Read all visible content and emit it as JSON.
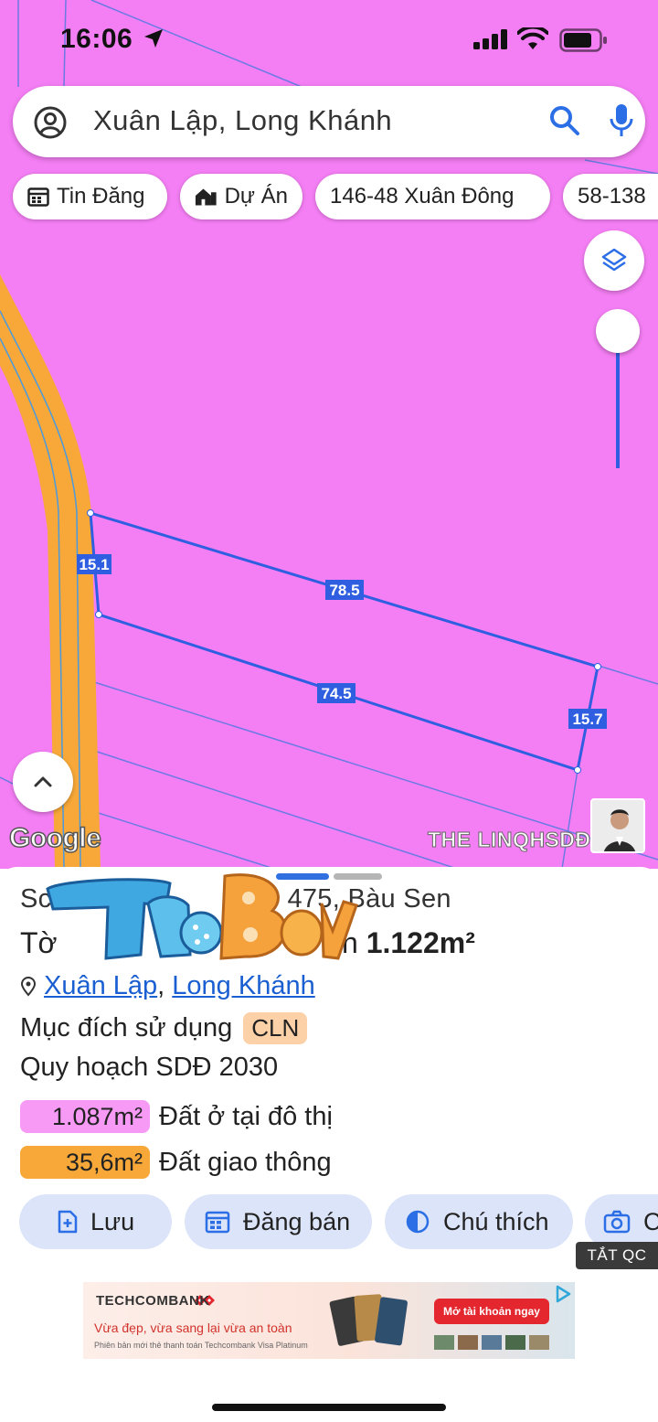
{
  "status_bar": {
    "time": "16:06"
  },
  "search": {
    "query": "Xuân Lập, Long Khánh"
  },
  "chips": [
    {
      "label": "Tin Đăng",
      "icon": "calendar-icon"
    },
    {
      "label": "Dự Án",
      "icon": "building-icon"
    },
    {
      "label": "146-48 Xuân Đông"
    },
    {
      "label": "58-138"
    }
  ],
  "map": {
    "background_color": "#f47ef4",
    "road_color": "#f7a838",
    "parcel_edge_color": "#2f5fe0",
    "edge_labels": [
      "15.1",
      "78.5",
      "74.5",
      "15.7"
    ],
    "attribution": "Google",
    "watermark": "THE LINQHSDĐ 2030"
  },
  "panel": {
    "title_visible": "Sc",
    "title_tail": "475, Bàu Sen",
    "sheet_prefix": "Tờ",
    "area_text": "ch ",
    "area_value": "1.122m²",
    "location": {
      "ward": "Xuân Lập",
      "separator": ",",
      "city": "Long Khánh"
    },
    "purpose_label": "Mục đích sử dụng",
    "purpose_code": "CLN",
    "plan_label": "Quy hoạch SDĐ 2030",
    "zones": [
      {
        "area": "1.087m²",
        "label": "Đất ở tại đô thị",
        "color": "#f79af5"
      },
      {
        "area": "35,6m²",
        "label": "Đất giao thông",
        "color": "#f7a838"
      }
    ],
    "actions": [
      {
        "label": "Lưu",
        "icon": "add-document-icon"
      },
      {
        "label": "Đăng bán",
        "icon": "calendar-icon"
      },
      {
        "label": "Chú thích",
        "icon": "contrast-icon"
      },
      {
        "label": "C",
        "icon": "camera-icon"
      }
    ]
  },
  "ad": {
    "close_label": "TẮT QC",
    "brand": "TECHCOMBANK",
    "headline": "Vừa đẹp, vừa sang lại vừa an toàn",
    "subline": "Phiên bản mới thẻ thanh toán Techcombank Visa Platinum",
    "cta": "Mở tài khoản ngay"
  }
}
